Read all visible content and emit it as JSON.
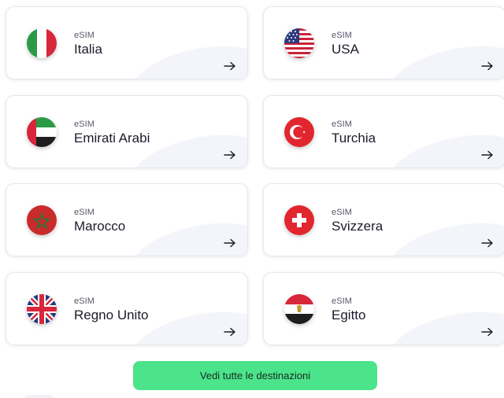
{
  "destinations": [
    {
      "label": "eSIM",
      "country": "Italia",
      "flag_icon": "italy-flag-icon"
    },
    {
      "label": "eSIM",
      "country": "USA",
      "flag_icon": "usa-flag-icon"
    },
    {
      "label": "eSIM",
      "country": "Emirati Arabi",
      "flag_icon": "uae-flag-icon"
    },
    {
      "label": "eSIM",
      "country": "Turchia",
      "flag_icon": "turkey-flag-icon"
    },
    {
      "label": "eSIM",
      "country": "Marocco",
      "flag_icon": "morocco-flag-icon"
    },
    {
      "label": "eSIM",
      "country": "Svizzera",
      "flag_icon": "switzerland-flag-icon"
    },
    {
      "label": "eSIM",
      "country": "Regno Unito",
      "flag_icon": "uk-flag-icon"
    },
    {
      "label": "eSIM",
      "country": "Egitto",
      "flag_icon": "egypt-flag-icon"
    }
  ],
  "cta": {
    "label": "Vedi tutte le destinazioni"
  },
  "colors": {
    "cta_background": "#4be48a",
    "card_border": "#e6e7ee",
    "text_primary": "#1b1c2b"
  }
}
